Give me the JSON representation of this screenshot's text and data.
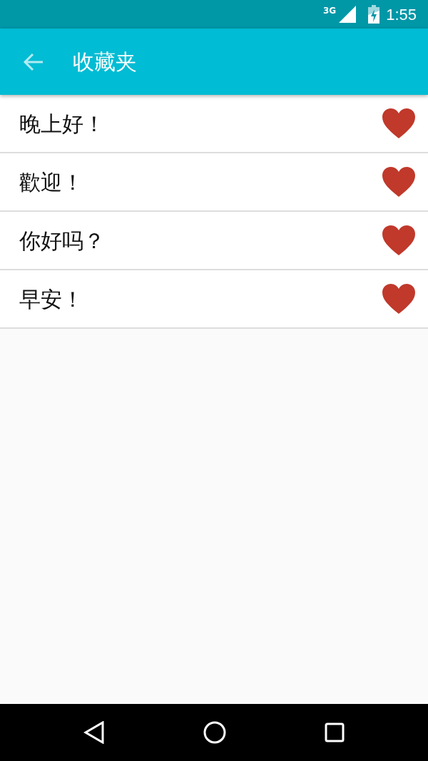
{
  "status_bar": {
    "network": "3G",
    "time": "1:55"
  },
  "app_bar": {
    "title": "收藏夹"
  },
  "items": [
    {
      "text": "晚上好！",
      "favorite": true
    },
    {
      "text": "歡迎！",
      "favorite": true
    },
    {
      "text": "你好吗？",
      "favorite": true
    },
    {
      "text": "早安！",
      "favorite": true
    }
  ]
}
